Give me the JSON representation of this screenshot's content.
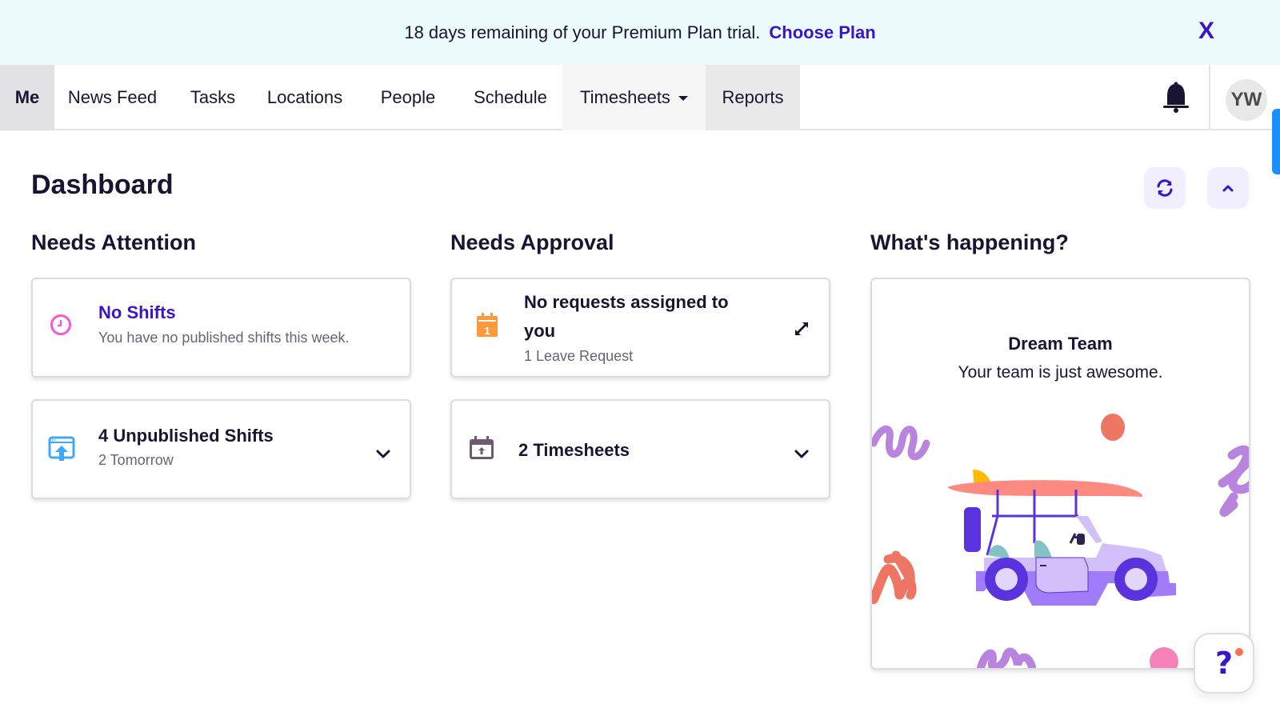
{
  "banner": {
    "message": "18 days remaining of your Premium Plan trial.",
    "link_label": "Choose Plan",
    "close_icon": "close-icon",
    "close_glyph": "X"
  },
  "nav": {
    "items": [
      {
        "label": "Me",
        "active": true
      },
      {
        "label": "News Feed"
      },
      {
        "label": "Tasks"
      },
      {
        "label": "Locations"
      },
      {
        "label": "People"
      },
      {
        "label": "Schedule"
      },
      {
        "label": "Timesheets",
        "has_dropdown": true
      },
      {
        "label": "Reports"
      }
    ],
    "notifications_icon": "bell-icon",
    "avatar_initials": "YW"
  },
  "dashboard": {
    "title": "Dashboard",
    "refresh_icon": "refresh-icon",
    "collapse_icon": "chevron-up-icon",
    "sections": {
      "needs_attention": {
        "title": "Needs Attention",
        "cards": [
          {
            "icon": "clock-icon",
            "title": "No Shifts",
            "subtitle": "You have no published shifts this week."
          },
          {
            "icon": "publish-icon",
            "title": "4 Unpublished Shifts",
            "subtitle": "2 Tomorrow",
            "action_icon": "chevron-down-icon"
          }
        ]
      },
      "needs_approval": {
        "title": "Needs Approval",
        "cards": [
          {
            "icon": "calendar-icon",
            "title_line1": "No requests assigned to",
            "title_line2": "you",
            "subtitle": "1 Leave Request",
            "action_icon": "expand-icon",
            "icon_number": "1"
          },
          {
            "icon": "timesheet-calendar-icon",
            "title": "2 Timesheets",
            "action_icon": "chevron-down-icon"
          }
        ]
      },
      "whats_happening": {
        "title": "What's happening?",
        "card_title": "Dream Team",
        "card_subtitle": "Your team is just awesome.",
        "illustration": "jeep-with-surfboard-illustration"
      }
    }
  },
  "help": {
    "icon": "help-icon",
    "glyph": "?"
  },
  "colors": {
    "brand": "#3a14c8",
    "banner_bg": "#ecfbfb",
    "text": "#1a1433",
    "clock_icon": "#f657d6",
    "publish_icon": "#3fa9f5",
    "calendar_icon": "#ff9a3c",
    "timesheet_icon": "#6d5a70",
    "scroll_indicator": "#1990ff"
  }
}
